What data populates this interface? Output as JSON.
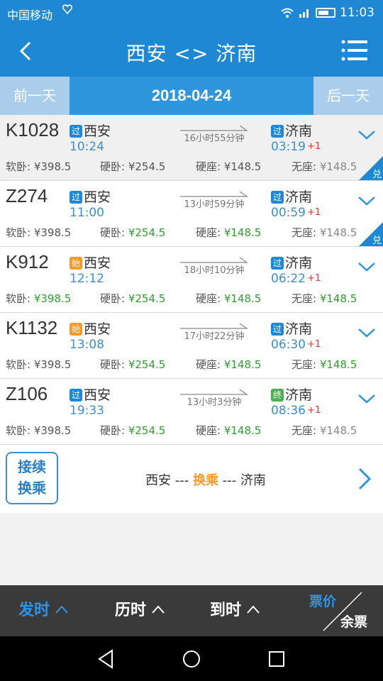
{
  "status_bar": {
    "carrier": "中国移动",
    "time": "11:03"
  },
  "header": {
    "title": "西安 <> 济南"
  },
  "date_bar": {
    "prev": "前一天",
    "date": "2018-04-24",
    "next": "后一天"
  },
  "trains": [
    {
      "no": "K1028",
      "dep_badge": "过",
      "dep_station": "西安",
      "dep_time": "10:24",
      "duration": "16小时55分钟",
      "arr_badge": "过",
      "arr_station": "济南",
      "arr_time": "03:19",
      "arr_plus": "+1",
      "seats": [
        {
          "label": "软卧: ",
          "price": "¥398.5"
        },
        {
          "label": "硬卧: ",
          "price": "¥254.5"
        },
        {
          "label": "硬座: ",
          "price": "¥148.5"
        },
        {
          "label": "无座: ",
          "price": "¥148.5"
        }
      ],
      "exchange": "兑"
    },
    {
      "no": "Z274",
      "dep_badge": "过",
      "dep_station": "西安",
      "dep_time": "11:00",
      "duration": "13小时59分钟",
      "arr_badge": "过",
      "arr_station": "济南",
      "arr_time": "00:59",
      "arr_plus": "+1",
      "seats": [
        {
          "label": "软卧: ",
          "price": "¥398.5"
        },
        {
          "label": "硬卧: ",
          "price": "¥254.5"
        },
        {
          "label": "硬座: ",
          "price": "¥148.5"
        },
        {
          "label": "无座: ",
          "price": "¥148.5"
        }
      ],
      "exchange": "兑"
    },
    {
      "no": "K912",
      "dep_badge": "始",
      "dep_station": "西安",
      "dep_time": "12:12",
      "duration": "18小时10分钟",
      "arr_badge": "过",
      "arr_station": "济南",
      "arr_time": "06:22",
      "arr_plus": "+1",
      "seats": [
        {
          "label": "软卧: ",
          "price": "¥398.5"
        },
        {
          "label": "硬卧: ",
          "price": "¥254.5"
        },
        {
          "label": "硬座: ",
          "price": "¥148.5"
        },
        {
          "label": "无座: ",
          "price": "¥148.5"
        }
      ]
    },
    {
      "no": "K1132",
      "dep_badge": "始",
      "dep_station": "西安",
      "dep_time": "13:08",
      "duration": "17小时22分钟",
      "arr_badge": "过",
      "arr_station": "济南",
      "arr_time": "06:30",
      "arr_plus": "+1",
      "seats": [
        {
          "label": "软卧: ",
          "price": "¥398.5"
        },
        {
          "label": "硬卧: ",
          "price": "¥254.5"
        },
        {
          "label": "硬座: ",
          "price": "¥148.5"
        },
        {
          "label": "无座: ",
          "price": "¥148.5"
        }
      ]
    },
    {
      "no": "Z106",
      "dep_badge": "过",
      "dep_station": "西安",
      "dep_time": "19:33",
      "duration": "13小时3分钟",
      "arr_badge": "终",
      "arr_station": "济南",
      "arr_time": "08:36",
      "arr_plus": "+1",
      "seats": [
        {
          "label": "软卧: ",
          "price": "¥398.5"
        },
        {
          "label": "硬卧: ",
          "price": "¥254.5"
        },
        {
          "label": "硬座: ",
          "price": "¥148.5"
        },
        {
          "label": "无座: ",
          "price": "¥148.5"
        }
      ]
    }
  ],
  "transfer": {
    "button_line1": "接续",
    "button_line2": "换乘",
    "from": "西安",
    "sep1": " --- ",
    "mid": "换乘",
    "sep2": " --- ",
    "to": "济南"
  },
  "sort_bar": {
    "depart": "发时",
    "duration": "历时",
    "arrive": "到时",
    "price": "票价",
    "remaining": "余票"
  },
  "colors": {
    "primary": "#1e88d4",
    "available_green": "#2e9e2e",
    "unavailable_gray": "#888888",
    "active_sort": "#2d95e6"
  }
}
